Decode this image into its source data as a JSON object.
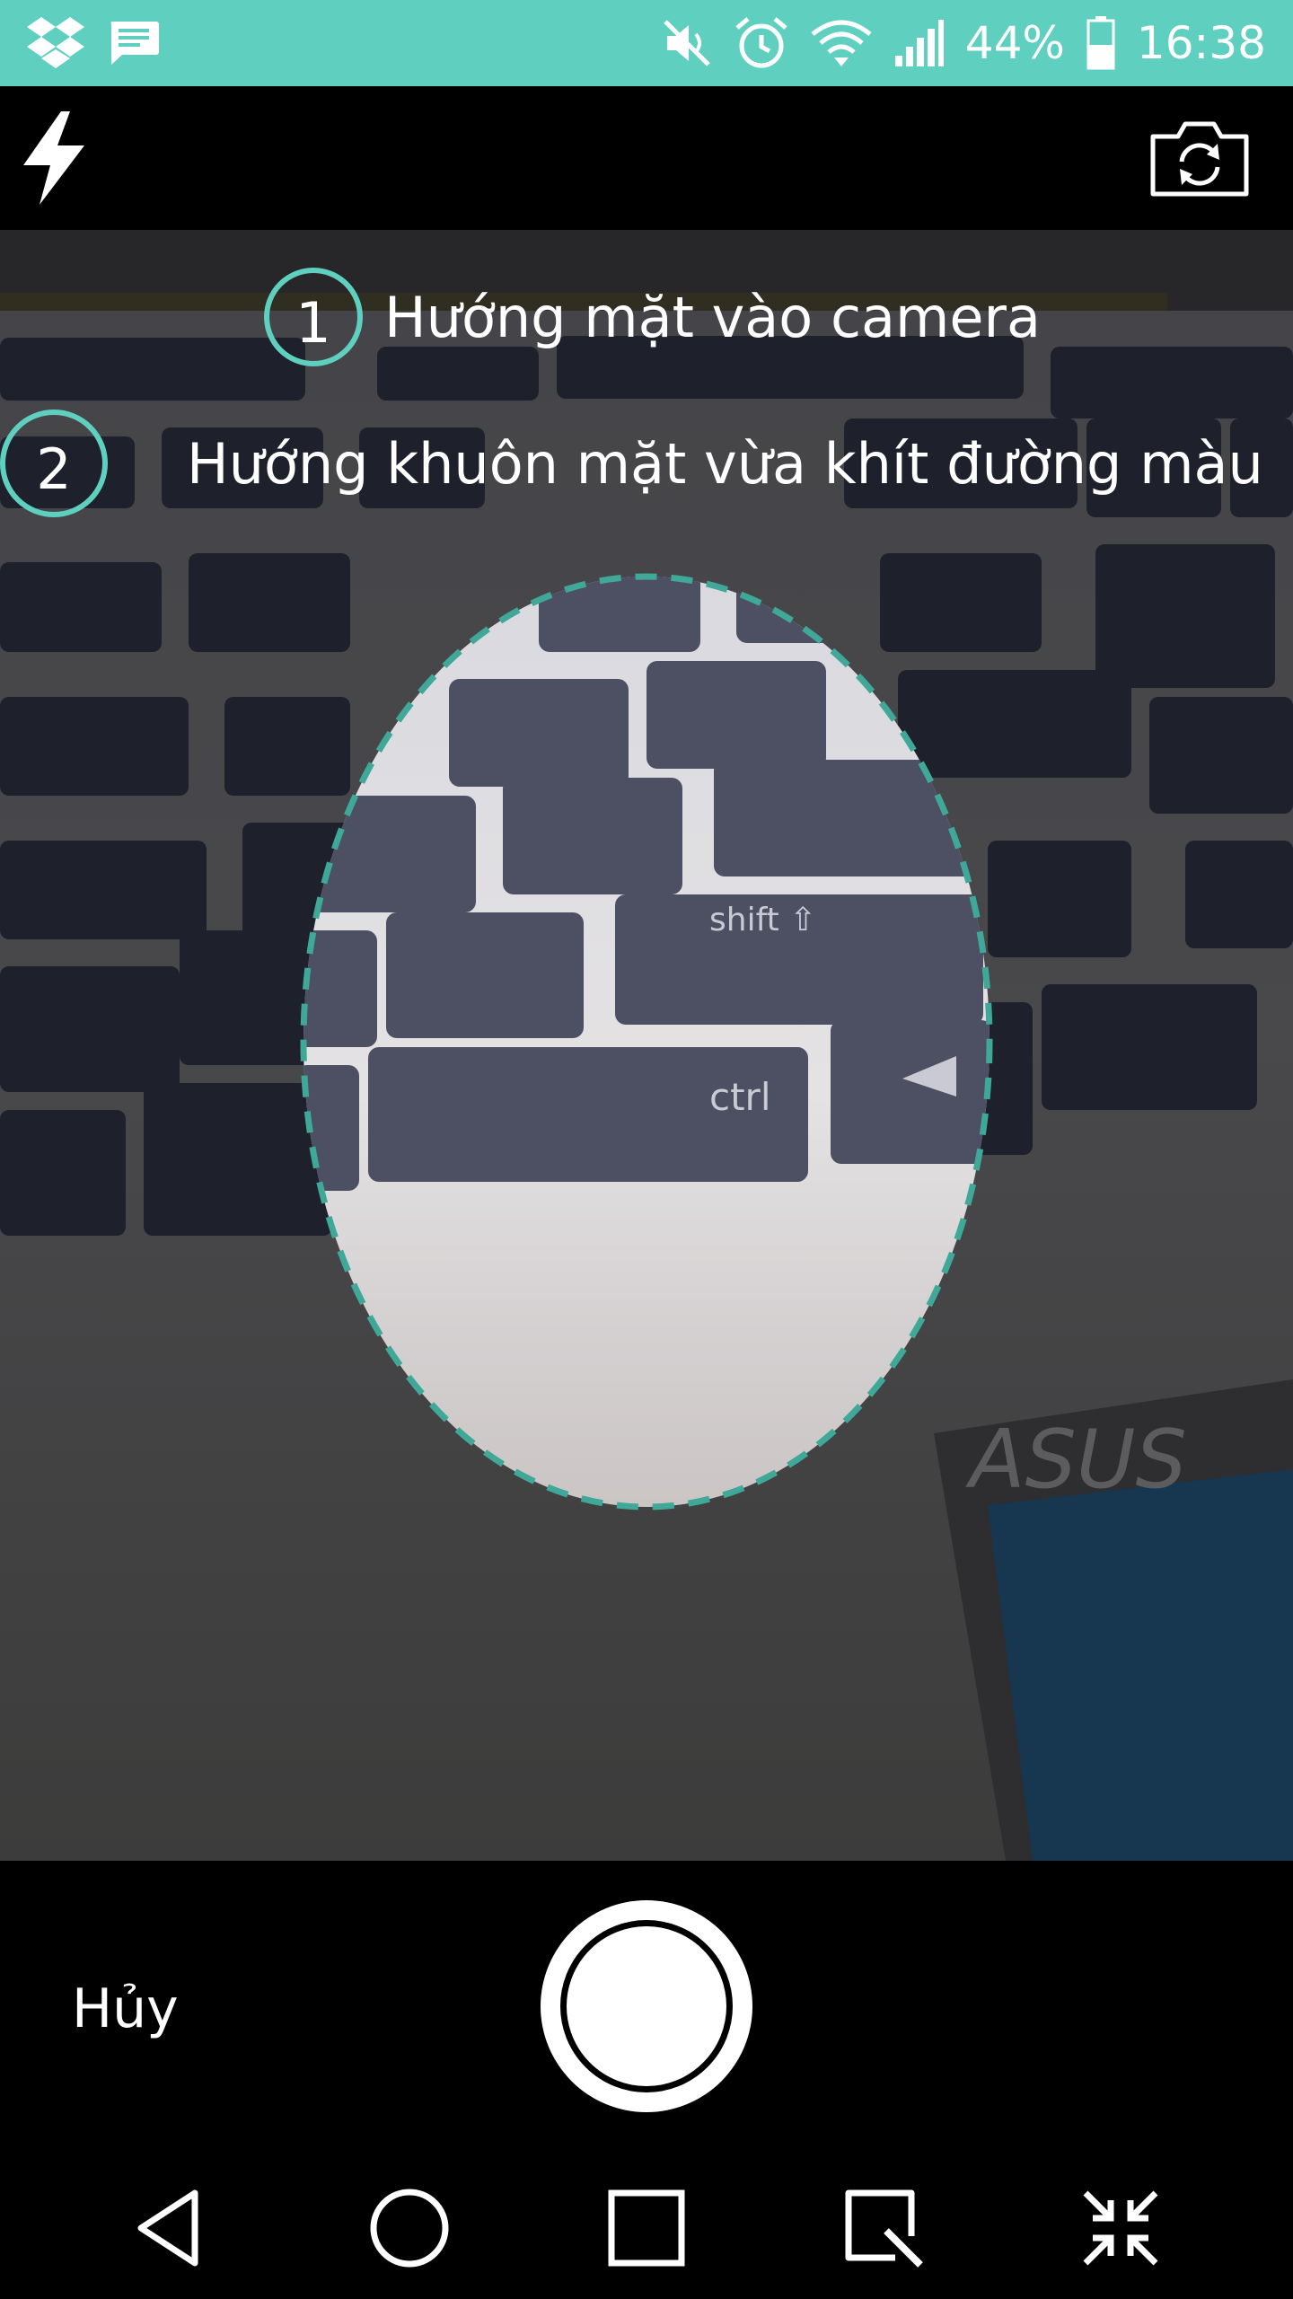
{
  "status_bar": {
    "battery": "44%",
    "time": "16:38",
    "background_color": "#5fd0bf",
    "left_icons": [
      "dropbox-icon",
      "message-icon"
    ],
    "right_icons": [
      "mute-icon",
      "alarm-icon",
      "wifi-icon",
      "signal-icon",
      "battery-icon"
    ]
  },
  "toolbar": {
    "flash_icon": "flash-icon",
    "switch_camera_icon": "switch-camera-icon"
  },
  "instructions": [
    {
      "number": "1",
      "text": "Hướng mặt vào camera"
    },
    {
      "number": "2",
      "text": "Hướng khuôn mặt vừa khít đường màu"
    }
  ],
  "face_guide": {
    "outline_color": "#3fa898",
    "style": "dashed-ellipse"
  },
  "controls": {
    "cancel_label": "Hủy",
    "shutter_icon": "shutter-icon"
  },
  "nav_bar": {
    "icons": [
      "back-icon",
      "home-icon",
      "recents-icon",
      "capture-icon",
      "shrink-icon"
    ]
  },
  "colors": {
    "accent": "#5fd0bf"
  }
}
